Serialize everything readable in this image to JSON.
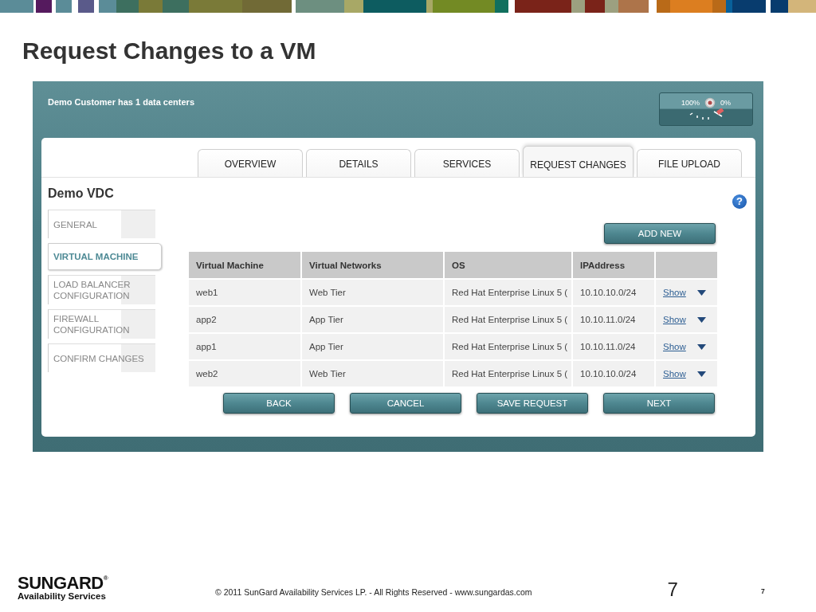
{
  "slide_title": "Request Changes to a VM",
  "app": {
    "header_text": "Demo Customer has 1 data centers",
    "zoom_labels": [
      "100%",
      "0%"
    ],
    "tabs": [
      {
        "label": "OVERVIEW",
        "selected": false
      },
      {
        "label": "DETAILS",
        "selected": false
      },
      {
        "label": "SERVICES",
        "selected": false
      },
      {
        "label": "REQUEST CHANGES",
        "selected": true
      },
      {
        "label": "FILE UPLOAD",
        "selected": false
      }
    ],
    "vdc_title": "Demo VDC",
    "sidebar": {
      "items": [
        {
          "label": "GENERAL",
          "selected": false
        },
        {
          "label": "VIRTUAL MACHINE",
          "selected": true
        },
        {
          "label": "LOAD BALANCER CONFIGURATION",
          "selected": false
        },
        {
          "label": "FIREWALL CONFIGURATION",
          "selected": false
        },
        {
          "label": "CONFIRM CHANGES",
          "selected": false
        }
      ]
    },
    "help_button": "?",
    "add_button": "ADD NEW",
    "table": {
      "columns": [
        "Virtual Machine",
        "Virtual Networks",
        "OS",
        "IPAddress"
      ],
      "rows": [
        {
          "cells": [
            "web1",
            "Web Tier",
            "Red Hat Enterprise Linux 5 (",
            "10.10.10.0/24"
          ],
          "link": "Show"
        },
        {
          "cells": [
            "app2",
            "App Tier",
            "Red Hat Enterprise Linux 5 (",
            "10.10.11.0/24"
          ],
          "link": "Show"
        },
        {
          "cells": [
            "app1",
            "App Tier",
            "Red Hat Enterprise Linux 5 (",
            "10.10.11.0/24"
          ],
          "link": "Show"
        },
        {
          "cells": [
            "web2",
            "Web Tier",
            "Red Hat Enterprise Linux 5 (",
            "10.10.10.0/24"
          ],
          "link": "Show"
        }
      ]
    },
    "buttons": [
      "BACK",
      "CANCEL",
      "SAVE REQUEST",
      "NEXT"
    ]
  },
  "footer": {
    "logo_name": "SUNGARD$^{®}$",
    "logo_tagline": "Availability Services",
    "copyright": "© 2011 SunGard Availability Services LP. - All Rights Reserved - www.sungardas.com",
    "page_number": "7",
    "slide_number": "7"
  }
}
